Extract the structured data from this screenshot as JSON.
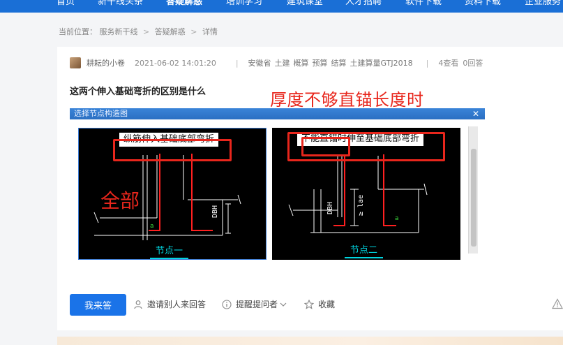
{
  "nav": {
    "items": [
      {
        "label": "首页",
        "active": false
      },
      {
        "label": "新干线头条",
        "active": false
      },
      {
        "label": "答疑解惑",
        "active": true
      },
      {
        "label": "培训学习",
        "active": false
      },
      {
        "label": "建筑课堂",
        "active": false
      },
      {
        "label": "人才招聘",
        "active": false
      },
      {
        "label": "软件下载",
        "active": false
      },
      {
        "label": "资料下载",
        "active": false
      },
      {
        "label": "企业服务",
        "active": false
      }
    ]
  },
  "breadcrumb": {
    "prefix": "当前位置：",
    "items": [
      "服务新干线",
      "答疑解惑",
      "详情"
    ],
    "separator": ">"
  },
  "question": {
    "author": "耕耘的小卷",
    "time": "2021-06-02 14:01:20",
    "tags": [
      "安徽省",
      "土建",
      "概算",
      "预算",
      "结算",
      "土建算量GTJ2018"
    ],
    "views": "4查看",
    "answers": "0回答",
    "title": "这两个伸入基础弯折的区别是什么"
  },
  "figure": {
    "annotation_top": "厚度不够直锚长度时",
    "annotation_left": "全部",
    "dialog_title": "选择节点构造图",
    "close_glyph": "✕",
    "left_panel": {
      "label": "纵筋伸入基础底部弯折",
      "node": "节点一",
      "dim": "DBH",
      "mark": "a"
    },
    "right_panel": {
      "label": "不能直锚时伸至基础底部弯折",
      "node": "节点二",
      "dim": "DBH",
      "dim2": "≥ lae",
      "mark": "a"
    }
  },
  "actions": {
    "answer_button": "我来答",
    "invite": "邀请别人来回答",
    "remind": "提醒提问者",
    "favorite": "收藏"
  },
  "icons": {
    "invite": "person-icon",
    "remind": "info-circle-icon",
    "favorite": "star-icon",
    "report": "warning-icon"
  },
  "colors": {
    "brand": "#1a73e8",
    "nav_bg": "#1a6fd6",
    "annotation": "#e8261c",
    "cad_cyan": "#00d5e0"
  }
}
